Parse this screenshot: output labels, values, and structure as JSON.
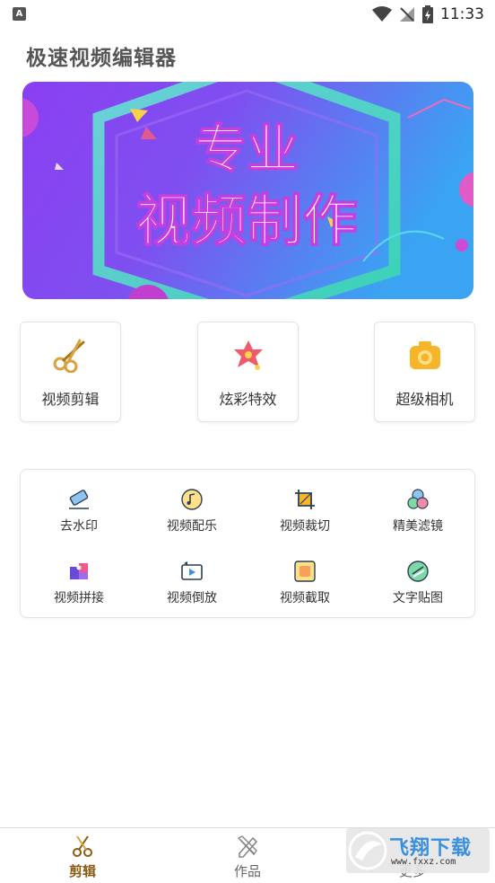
{
  "status_bar": {
    "app_badge": "A",
    "time": "11:33"
  },
  "app": {
    "title": "极速视频编辑器"
  },
  "banner": {
    "line1": "专业",
    "line2": "视频制作"
  },
  "features": [
    {
      "label": "视频剪辑",
      "icon": "scissors-icon"
    },
    {
      "label": "炫彩特效",
      "icon": "sparkle-icon"
    },
    {
      "label": "超级相机",
      "icon": "camera-icon"
    }
  ],
  "tools": [
    {
      "label": "去水印",
      "icon": "eraser-icon"
    },
    {
      "label": "视频配乐",
      "icon": "music-icon"
    },
    {
      "label": "视频裁切",
      "icon": "crop-icon"
    },
    {
      "label": "精美滤镜",
      "icon": "filter-icon"
    },
    {
      "label": "视频拼接",
      "icon": "puzzle-icon"
    },
    {
      "label": "视频倒放",
      "icon": "reverse-play-icon"
    },
    {
      "label": "视频截取",
      "icon": "capture-icon"
    },
    {
      "label": "文字贴图",
      "icon": "sticker-icon"
    }
  ],
  "bottom_nav": [
    {
      "label": "剪辑",
      "icon": "scissors-icon",
      "active": true
    },
    {
      "label": "作品",
      "icon": "pencil-ruler-icon",
      "active": false
    },
    {
      "label": "更多",
      "icon": "more-icon",
      "active": false
    }
  ],
  "watermark": {
    "text": "飞翔下载",
    "url": "www.fxxz.com"
  },
  "colors": {
    "accent": "#d9a23a",
    "active_nav": "#8a5a10",
    "banner_left": "#7d3df0",
    "banner_right": "#3fa0f0"
  }
}
